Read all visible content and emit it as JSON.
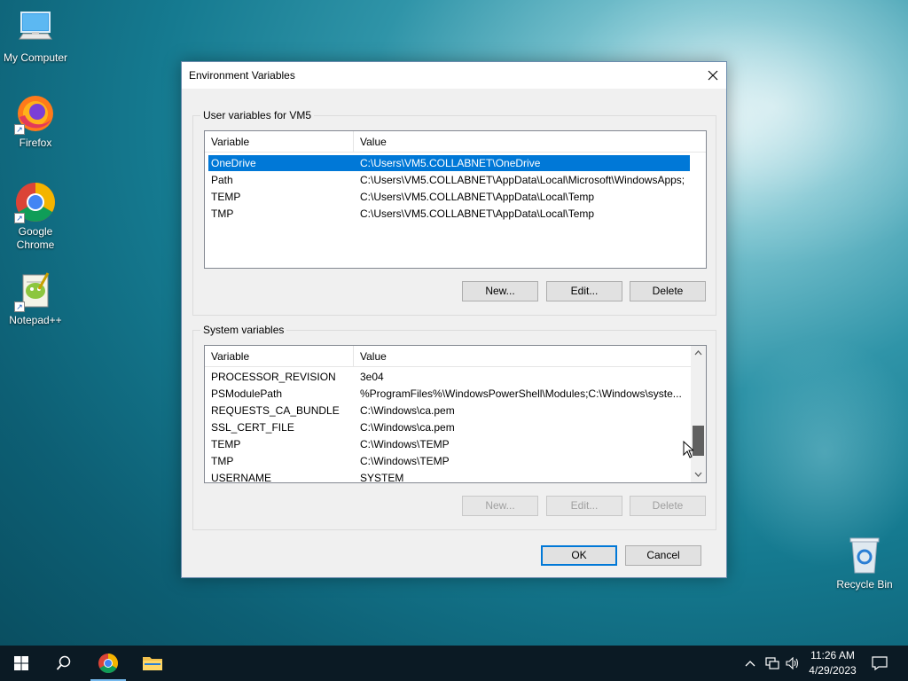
{
  "desktop": {
    "icons": [
      {
        "label": "My Computer"
      },
      {
        "label": "Firefox"
      },
      {
        "label": "Google Chrome"
      },
      {
        "label": "Notepad++"
      },
      {
        "label": "Recycle Bin"
      }
    ]
  },
  "dialog": {
    "title": "Environment Variables",
    "user_group": {
      "title": "User variables for VM5",
      "columns": [
        "Variable",
        "Value"
      ],
      "rows": [
        {
          "variable": "OneDrive",
          "value": "C:\\Users\\VM5.COLLABNET\\OneDrive"
        },
        {
          "variable": "Path",
          "value": "C:\\Users\\VM5.COLLABNET\\AppData\\Local\\Microsoft\\WindowsApps;"
        },
        {
          "variable": "TEMP",
          "value": "C:\\Users\\VM5.COLLABNET\\AppData\\Local\\Temp"
        },
        {
          "variable": "TMP",
          "value": "C:\\Users\\VM5.COLLABNET\\AppData\\Local\\Temp"
        }
      ],
      "buttons": {
        "new": "New...",
        "edit": "Edit...",
        "delete": "Delete"
      }
    },
    "system_group": {
      "title": "System variables",
      "columns": [
        "Variable",
        "Value"
      ],
      "rows": [
        {
          "variable": "PROCESSOR_REVISION",
          "value": "3e04"
        },
        {
          "variable": "PSModulePath",
          "value": "%ProgramFiles%\\WindowsPowerShell\\Modules;C:\\Windows\\syste..."
        },
        {
          "variable": "REQUESTS_CA_BUNDLE",
          "value": "C:\\Windows\\ca.pem"
        },
        {
          "variable": "SSL_CERT_FILE",
          "value": "C:\\Windows\\ca.pem"
        },
        {
          "variable": "TEMP",
          "value": "C:\\Windows\\TEMP"
        },
        {
          "variable": "TMP",
          "value": "C:\\Windows\\TEMP"
        },
        {
          "variable": "USERNAME",
          "value": "SYSTEM"
        }
      ],
      "buttons": {
        "new": "New...",
        "edit": "Edit...",
        "delete": "Delete"
      }
    },
    "ok": "OK",
    "cancel": "Cancel"
  },
  "taskbar": {
    "time": "11:26 AM",
    "date": "4/29/2023"
  },
  "colors": {
    "selection": "#0078d7",
    "taskbar": "#0b1a24"
  }
}
